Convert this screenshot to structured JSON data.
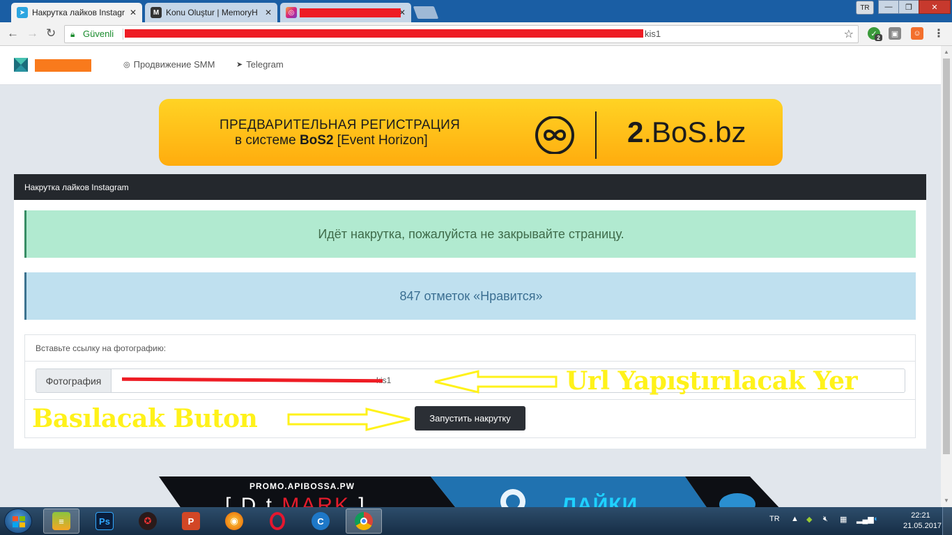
{
  "browser": {
    "tabs": [
      {
        "label": "Накрутка лайков Instagr",
        "icon": "telegram-icon",
        "active": true
      },
      {
        "label": "Konu Oluştur | MemoryH",
        "icon": "memoryhackers-icon",
        "active": false
      },
      {
        "label": "",
        "icon": "instagram-icon",
        "active": false
      }
    ],
    "window": {
      "lang": "TR",
      "minimize": "—",
      "maximize": "❐",
      "close": "✕"
    },
    "address": {
      "secure_label": "Güvenli",
      "url_tail": "kis1"
    },
    "extension_badge": "2"
  },
  "site": {
    "nav": [
      {
        "label": "Продвижение SMM",
        "icon": "instagram-icon"
      },
      {
        "label": "Telegram",
        "icon": "telegram-icon"
      }
    ],
    "banner": {
      "line1": "ПРЕДВАРИТЕЛЬНАЯ РЕГИСТРАЦИЯ",
      "line2_prefix": "в системе ",
      "line2_bold": "BoS2",
      "line2_suffix": " [Event Horizon]",
      "domain_bold": "2",
      "domain_rest": ".BoS.bz"
    },
    "card": {
      "title": "Накрутка лайков Instagram",
      "status_message": "Идёт накрутка, пожалуйста не закрывайте страницу.",
      "likes_message": "847 отметок «Нравится»",
      "form_label": "Вставьте ссылку на фотографию:",
      "input_addon": "Фотография",
      "input_value_tail": "kis1",
      "submit_label": "Запустить накрутку"
    },
    "annotations": {
      "url_note": "Url Yapıştırılacak Yer",
      "button_note": "Basılacak Buton"
    },
    "bottom_banner": {
      "promo": "PROMO.APIBOSSA.PW",
      "brand_prefix": "[ D  t ",
      "brand_red": "MARK",
      "brand_suffix": " ]",
      "likes": "ЛАЙКИ"
    }
  },
  "taskbar": {
    "tray_lang": "TR",
    "time": "22:21",
    "date": "21.05.2017"
  },
  "colors": {
    "title_bar": "#1a5ea4",
    "banner_yellow": "#ffc21a",
    "card_header": "#24282d",
    "alert_green": "#b1ead0",
    "alert_blue": "#bfe0ef",
    "annotation_yellow": "#fff21a",
    "redaction_red": "#ee1c24"
  }
}
